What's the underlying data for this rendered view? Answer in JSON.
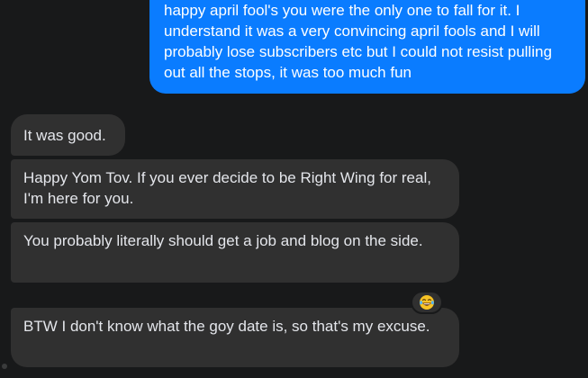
{
  "messages": {
    "outgoing": {
      "text": "happy april fool's you were the only one to fall for it. I understand it was a very convincing april fools and I will probably lose subscribers etc but I could not resist pulling out all the stops, it was too much fun"
    },
    "incoming": [
      {
        "text": "It was good."
      },
      {
        "text": "Happy Yom Tov. If you ever decide to be Right Wing for real, I'm here for you."
      },
      {
        "text": "You probably literally should get a job and blog on the side."
      },
      {
        "text": "BTW I don't know what the goy date is, so that's my excuse."
      }
    ]
  },
  "reaction": {
    "icon": "laughing-tears-emoji-icon"
  },
  "colors": {
    "background": "#18191a",
    "outgoing_bubble": "#0a7cff",
    "incoming_bubble": "#303030",
    "incoming_text": "#e4e6eb",
    "outgoing_text": "#ffffff"
  }
}
